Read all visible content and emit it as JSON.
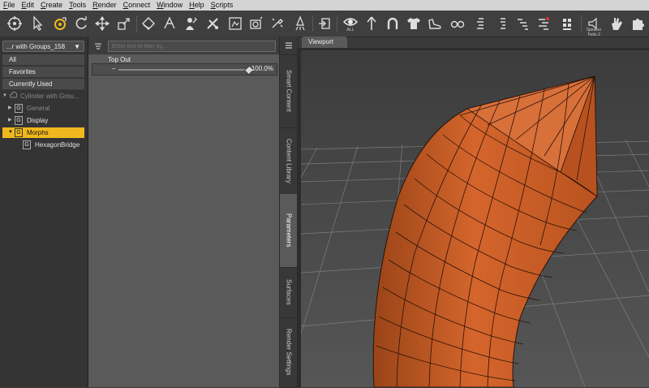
{
  "menu": [
    {
      "label": "File"
    },
    {
      "label": "Edit"
    },
    {
      "label": "Create"
    },
    {
      "label": "Tools"
    },
    {
      "label": "Render"
    },
    {
      "label": "Connect"
    },
    {
      "label": "Window"
    },
    {
      "label": "Help"
    },
    {
      "label": "Scripts"
    }
  ],
  "toolbar": {
    "icons": [
      "node-selection-icon",
      "pointer-icon",
      "universal-tool-icon",
      "rotate-icon",
      "translate-icon",
      "scale-icon",
      "geometry-editor-icon",
      "joint-editor-icon",
      "node-weight-brush-icon",
      "surface-selection-icon",
      "spot-render-icon",
      "render-icon",
      "render-settings-icon",
      "import-icon",
      "view-all-icon",
      "up-arrow-icon",
      "horseshoe-icon",
      "shirt-icon",
      "shoe-icon",
      "glasses-icon",
      "morph-list-icon",
      "pose-list-icon",
      "align-list-icon",
      "grid-list-icon",
      "speaker-tools-icon",
      "hand-icon",
      "puzzle-icon"
    ],
    "eye_caption": "ALL",
    "speaker_caption": "Speaker Tools 2"
  },
  "left_panel": {
    "group_select": "...r with Groups_158",
    "nav": [
      "All",
      "Favorites",
      "Currently Used"
    ],
    "tree": {
      "root": "Cylinder with Grou...",
      "items": [
        {
          "label": "General"
        },
        {
          "label": "Display"
        },
        {
          "label": "Morphs"
        },
        {
          "label": "HexagonBridge"
        }
      ]
    }
  },
  "params": {
    "filter_placeholder": "Enter text to filter by...",
    "slider": {
      "label": "Top Out",
      "value_text": "100.0%",
      "value": 1.0
    }
  },
  "side_tabs": [
    "Smart Content",
    "Content Library",
    "Parameters",
    "Surfaces",
    "Render Settings"
  ],
  "viewport": {
    "tab_label": "Viewport"
  },
  "colors": {
    "highlight": "#f0b81e",
    "object": "#c85a23",
    "background": "#3a3a3a"
  }
}
